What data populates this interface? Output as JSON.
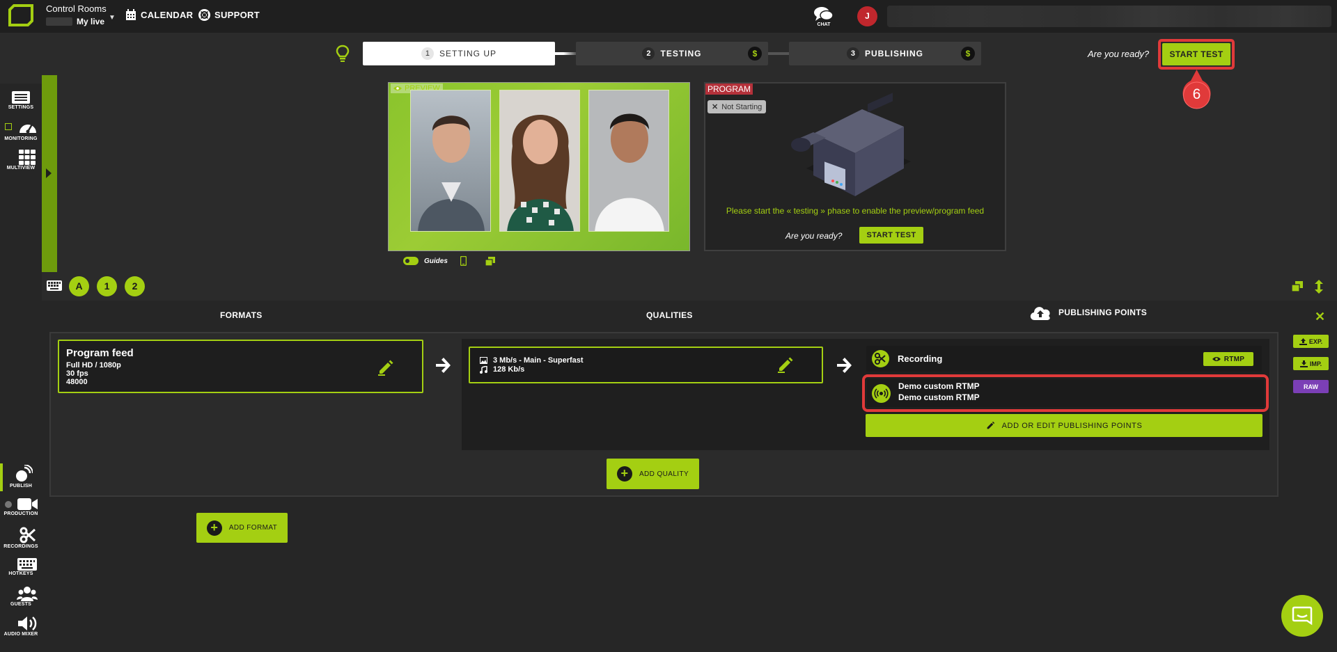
{
  "header": {
    "app_title": "Control Rooms",
    "live_name": "My live",
    "nav": [
      {
        "label": "CALENDAR",
        "icon": "calendar-icon"
      },
      {
        "label": "SUPPORT",
        "icon": "lifebuoy-icon"
      }
    ],
    "chat_label": "CHAT",
    "avatar_initial": "J"
  },
  "steps": [
    {
      "num": "1",
      "label": "SETTING UP",
      "active": true
    },
    {
      "num": "2",
      "label": "TESTING",
      "badge": "$"
    },
    {
      "num": "3",
      "label": "PUBLISHING",
      "badge": "$"
    }
  ],
  "ready_prompt": "Are you ready?",
  "start_test_label": "START TEST",
  "callout_number": "6",
  "left_rail": {
    "top": [
      {
        "label": "SETTINGS",
        "icon": "settings-panel-icon"
      },
      {
        "label": "MONITORING",
        "icon": "gauge-icon"
      },
      {
        "label": "MULTIVIEW",
        "icon": "grid-icon"
      }
    ],
    "bottom": [
      {
        "label": "PUBLISH",
        "icon": "broadcast-icon"
      },
      {
        "label": "PRODUCTION",
        "icon": "video-camera-icon"
      },
      {
        "label": "RECORDINGS",
        "icon": "scissors-icon"
      },
      {
        "label": "HOTKEYS",
        "icon": "keyboard-icon"
      },
      {
        "label": "GUESTS",
        "icon": "users-icon"
      },
      {
        "label": "AUDIO MIXER",
        "icon": "speaker-icon"
      }
    ]
  },
  "preview": {
    "label": "PREVIEW",
    "guides_label": "Guides"
  },
  "program": {
    "label": "PROGRAM",
    "status": "Not Starting",
    "message": "Please start the « testing » phase to enable the preview/program feed",
    "ready_prompt": "Are you ready?",
    "start_label": "START TEST"
  },
  "scene_chips": [
    "A",
    "1",
    "2"
  ],
  "workflow": {
    "headers": {
      "formats": "FORMATS",
      "qualities": "QUALITIES",
      "publishing_points": "PUBLISHING POINTS"
    },
    "format": {
      "title": "Program feed",
      "lines": [
        "Full HD / 1080p",
        "30 fps",
        "48000"
      ]
    },
    "quality": {
      "video": "3 Mb/s  -  Main  -  Superfast",
      "audio": "128 Kb/s"
    },
    "publishing_points": [
      {
        "name": "Recording",
        "badge": "RTMP"
      },
      {
        "name": "Demo custom RTMP",
        "subname": "Demo custom RTMP"
      }
    ],
    "add_edit_publishing_label": "ADD OR EDIT PUBLISHING POINTS",
    "add_quality_label": "ADD QUALITY",
    "add_format_label": "ADD FORMAT"
  },
  "right_rail": {
    "exp_label": "EXP.",
    "imp_label": "IMP.",
    "raw_label": "RAW"
  },
  "colors": {
    "accent": "#a4cf12",
    "highlight": "#e03a3a",
    "program_tag": "#b4313a",
    "raw": "#7b3fb6"
  }
}
